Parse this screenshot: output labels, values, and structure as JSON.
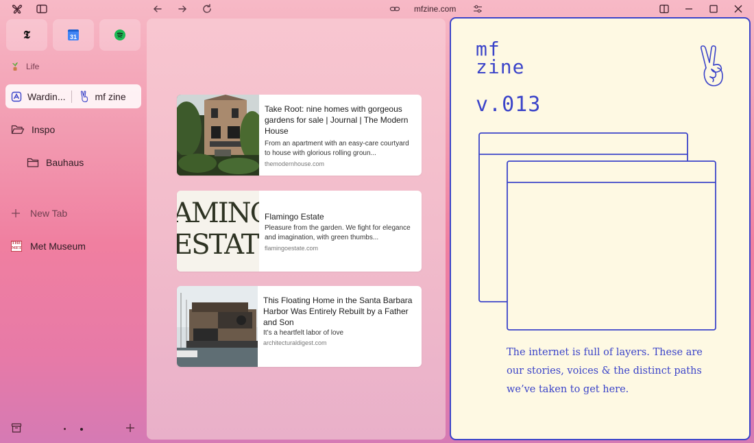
{
  "topbar": {
    "url": "mfzine.com",
    "icons": [
      "browser-logo-icon",
      "sidebar-toggle-icon",
      "back-arrow-icon",
      "forward-arrow-icon",
      "reload-icon",
      "link-icon",
      "site-settings-icon",
      "split-view-icon",
      "minimize-icon",
      "maximize-icon",
      "close-icon"
    ]
  },
  "sidebar": {
    "favorites": [
      {
        "name": "The New York Times",
        "glyph": "𝕿"
      },
      {
        "name": "Google Calendar",
        "glyph": "31"
      },
      {
        "name": "Spotify",
        "glyph": ""
      }
    ],
    "space_label": "Life",
    "split_tab": {
      "left_label": "Wardin...",
      "right_label": "mf zine"
    },
    "folders": [
      {
        "label": "Inspo"
      },
      {
        "label": "Bauhaus"
      }
    ],
    "new_tab_label": "New Tab",
    "met_label": "Met Museum",
    "met_badge": "THE MET",
    "bottom_icons": [
      "archive-icon",
      "space-dot-icon",
      "space-dot-icon",
      "add-icon"
    ]
  },
  "cards": [
    {
      "title": "Take Root: nine homes with gorgeous gardens for sale | Journal | The Modern House",
      "desc": "From an apartment with an easy-care courtyard to house with glorious rolling groun...",
      "domain": "themodernhouse.com"
    },
    {
      "title": "Flamingo Estate",
      "desc": "Pleasure from the garden. We fight for elegance and imagination, with green thumbs...",
      "domain": "flamingoestate.com",
      "thumb_text_top": "AMINC",
      "thumb_text_bottom": "ESTATI"
    },
    {
      "title": "This Floating Home in the Santa Barbara Harbor Was Entirely Rebuilt by a Father and Son",
      "desc": "It’s a heartfelt labor of love",
      "domain": "architecturaldigest.com"
    }
  ],
  "zine": {
    "logo_line1": "mf",
    "logo_line2": "zine",
    "version": "v.013",
    "text": "The internet is full of layers. These are our stories, voices & the distinct paths we’ve taken to get here.",
    "accent": "#3b44c9",
    "background": "#fef9e3"
  }
}
